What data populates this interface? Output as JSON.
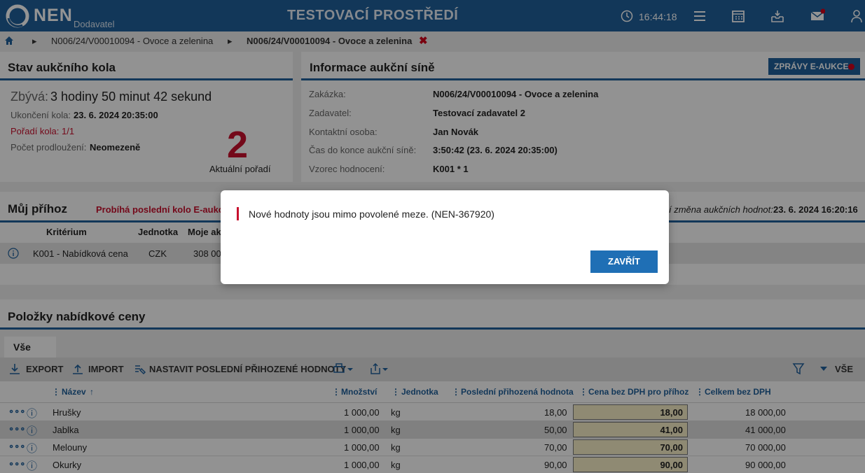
{
  "header": {
    "logo_text": "NEN",
    "logo_sub": "Dodavatel",
    "env_title": "TESTOVACÍ PROSTŘEDÍ",
    "clock": "16:44:18"
  },
  "breadcrumb": {
    "item1": "N006/24/V00010094 - Ovoce a zelenina",
    "item2": "N006/24/V00010094 - Ovoce a zelenina"
  },
  "status_panel": {
    "title": "Stav aukčního kola",
    "remaining_label": "Zbývá:",
    "remaining_value": "3 hodiny 50 minut 42 sekund",
    "end_label": "Ukončení kola:",
    "end_value": "23. 6. 2024 20:35:00",
    "round_label": "Pořadí kola: 1/1",
    "ext_label": "Počet prodloužení:",
    "ext_value": "Neomezeně",
    "rank": "2",
    "rank_label": "Aktuální pořadí"
  },
  "info_panel": {
    "title": "Informace aukční síně",
    "messages_button": "ZPRÁVY E-AUKCE",
    "rows": [
      {
        "label": "Zakázka:",
        "value": "N006/24/V00010094 - Ovoce a zelenina"
      },
      {
        "label": "Zadavatel:",
        "value": "Testovací zadavatel 2"
      },
      {
        "label": "Kontaktní osoba:",
        "value": "Jan Novák"
      },
      {
        "label": "Čas do konce aukční síně:",
        "value": "3:50:42 (23. 6. 2024 20:35:00)"
      },
      {
        "label": "Vzorec hodnocení:",
        "value": "K001 * 1"
      }
    ]
  },
  "bid_panel": {
    "title": "Můj příhoz",
    "notice": "Probíhá poslední kolo E-aukce",
    "last_change_label": "í změna aukčních hodnot:",
    "last_change_value": "23. 6. 2024 16:20:16",
    "col_criterion": "Kritérium",
    "col_unit": "Jednotka",
    "col_mine": "Moje ak",
    "row_criterion": "K001 - Nabídková cena",
    "row_unit": "CZK",
    "row_mine": "308 00"
  },
  "items_panel": {
    "title": "Položky nabídkové ceny",
    "tab": "Vše",
    "export": "EXPORT",
    "import": "IMPORT",
    "set_last": "NASTAVIT POSLEDNÍ PŘIHOZENÉ HODNOTY",
    "filter_all": "VŠE",
    "columns": {
      "name": "Název",
      "qty": "Množství",
      "unit": "Jednotka",
      "last": "Poslední přihozená hodnota",
      "price": "Cena bez DPH pro příhoz",
      "total": "Celkem bez DPH"
    },
    "rows": [
      {
        "name": "Hrušky",
        "qty": "1 000,00",
        "unit": "kg",
        "last": "18,00",
        "price": "18,00",
        "total": "18 000,00"
      },
      {
        "name": "Jablka",
        "qty": "1 000,00",
        "unit": "kg",
        "last": "50,00",
        "price": "41,00",
        "total": "41 000,00"
      },
      {
        "name": "Melouny",
        "qty": "1 000,00",
        "unit": "kg",
        "last": "70,00",
        "price": "70,00",
        "total": "70 000,00"
      },
      {
        "name": "Okurky",
        "qty": "1 000,00",
        "unit": "kg",
        "last": "90,00",
        "price": "90,00",
        "total": "90 000,00"
      }
    ]
  },
  "modal": {
    "message": "Nové hodnoty jsou mimo povolené meze. (NEN-367920)",
    "close": "ZAVŘÍT"
  }
}
